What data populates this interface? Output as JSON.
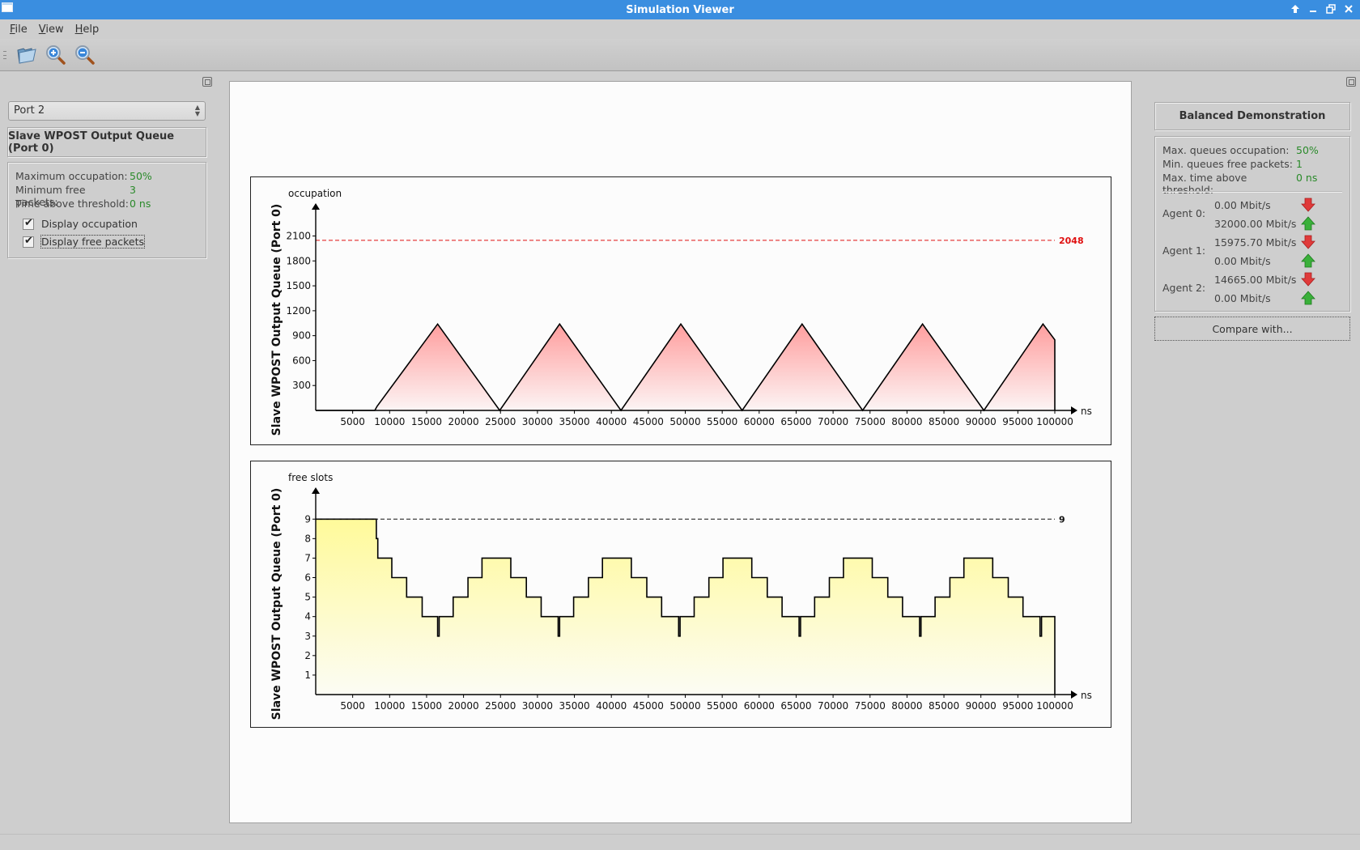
{
  "window": {
    "title": "Simulation Viewer",
    "controls": [
      "keep-above",
      "minimize",
      "maximize",
      "close"
    ]
  },
  "menu": {
    "items": [
      {
        "label": "File",
        "mnemonic": "F",
        "rest": "ile"
      },
      {
        "label": "View",
        "mnemonic": "V",
        "rest": "iew"
      },
      {
        "label": "Help",
        "mnemonic": "H",
        "rest": "elp"
      }
    ]
  },
  "toolbar": {
    "buttons": [
      {
        "name": "open-button",
        "icon": "folder-open-icon"
      },
      {
        "name": "zoom-in-button",
        "icon": "zoom-in-icon"
      },
      {
        "name": "zoom-out-button",
        "icon": "zoom-out-icon"
      }
    ]
  },
  "left_panel": {
    "port_select": {
      "value": "Port 2"
    },
    "queue_title": "Slave WPOST Output Queue (Port 0)",
    "stats": [
      {
        "label": "Maximum occupation:",
        "value": "50%"
      },
      {
        "label": "Minimum free packets:",
        "value": "3"
      },
      {
        "label": "Time above threshold:",
        "value": "0 ns"
      }
    ],
    "checkboxes": [
      {
        "label": "Display occupation",
        "checked": true
      },
      {
        "label": "Display free packets",
        "checked": true
      }
    ]
  },
  "right_panel": {
    "scenario_title": "Balanced Demonstration",
    "summary": [
      {
        "label": "Max. queues occupation:",
        "value": "50%"
      },
      {
        "label": "Min. queues free packets:",
        "value": "1"
      },
      {
        "label": "Max. time above threshold:",
        "value": "0 ns"
      }
    ],
    "agents": [
      {
        "label": "Agent 0:",
        "down": "0.00 Mbit/s",
        "up": "32000.00 Mbit/s"
      },
      {
        "label": "Agent 1:",
        "down": "15975.70 Mbit/s",
        "up": "0.00 Mbit/s"
      },
      {
        "label": "Agent 2:",
        "down": "14665.00 Mbit/s",
        "up": "0.00 Mbit/s"
      }
    ],
    "compare_label": "Compare with...",
    "colors": {
      "down_arrow": "#e03a3a",
      "up_arrow": "#3ab03a",
      "value_green": "#2a8a2a"
    }
  },
  "chart_data": [
    {
      "type": "area",
      "title": "",
      "ylabel": "Slave WPOST Output Queue (Port 0)",
      "y_axis_caption": "occupation",
      "xlabel": "ns",
      "xlim": [
        0,
        100000
      ],
      "ylim": [
        0,
        2300
      ],
      "x_ticks": [
        5000,
        10000,
        15000,
        20000,
        25000,
        30000,
        35000,
        40000,
        45000,
        50000,
        55000,
        60000,
        65000,
        70000,
        75000,
        80000,
        85000,
        90000,
        95000,
        100000
      ],
      "y_ticks": [
        300,
        600,
        900,
        1200,
        1500,
        1800,
        2100
      ],
      "threshold": {
        "value": 2048,
        "label": "2048",
        "color": "#e01010",
        "style": "dashed"
      },
      "fill_color": "#ff9e9e",
      "series": [
        {
          "name": "occupation",
          "x": [
            0,
            8000,
            8300,
            16500,
            24900,
            33000,
            41300,
            49400,
            57700,
            65800,
            74000,
            82100,
            90400,
            98400,
            100000,
            100000
          ],
          "y": [
            0,
            0,
            50,
            1040,
            0,
            1040,
            0,
            1040,
            0,
            1040,
            0,
            1040,
            0,
            1040,
            850,
            0
          ]
        }
      ]
    },
    {
      "type": "area",
      "title": "",
      "ylabel": "Slave WPOST Output Queue (Port 0)",
      "y_axis_caption": "free slots",
      "xlabel": "ns",
      "xlim": [
        0,
        100000
      ],
      "ylim": [
        0,
        9.8
      ],
      "x_ticks": [
        5000,
        10000,
        15000,
        20000,
        25000,
        30000,
        35000,
        40000,
        45000,
        50000,
        55000,
        60000,
        65000,
        70000,
        75000,
        80000,
        85000,
        90000,
        95000,
        100000
      ],
      "y_ticks": [
        1,
        2,
        3,
        4,
        5,
        6,
        7,
        8,
        9
      ],
      "threshold": {
        "value": 9,
        "label": "9",
        "color": "#111111",
        "style": "dashed"
      },
      "fill_color": "#fffa9a",
      "series": [
        {
          "name": "free slots",
          "steps": [
            [
              0,
              9
            ],
            [
              8200,
              8
            ],
            [
              8400,
              7
            ],
            [
              10300,
              6
            ],
            [
              12300,
              5
            ],
            [
              14400,
              4
            ],
            [
              16500,
              3
            ],
            [
              16700,
              4
            ],
            [
              18600,
              5
            ],
            [
              20600,
              6
            ],
            [
              22500,
              7
            ],
            [
              26400,
              6
            ],
            [
              28500,
              5
            ],
            [
              30500,
              4
            ],
            [
              32800,
              3
            ],
            [
              33000,
              4
            ],
            [
              34900,
              5
            ],
            [
              36900,
              6
            ],
            [
              38800,
              7
            ],
            [
              42700,
              6
            ],
            [
              44800,
              5
            ],
            [
              46800,
              4
            ],
            [
              49100,
              3
            ],
            [
              49300,
              4
            ],
            [
              51200,
              5
            ],
            [
              53200,
              6
            ],
            [
              55100,
              7
            ],
            [
              59000,
              6
            ],
            [
              61100,
              5
            ],
            [
              63100,
              4
            ],
            [
              65400,
              3
            ],
            [
              65600,
              4
            ],
            [
              67500,
              5
            ],
            [
              69500,
              6
            ],
            [
              71400,
              7
            ],
            [
              75300,
              6
            ],
            [
              77400,
              5
            ],
            [
              79400,
              4
            ],
            [
              81700,
              3
            ],
            [
              81900,
              4
            ],
            [
              83800,
              5
            ],
            [
              85800,
              6
            ],
            [
              87700,
              7
            ],
            [
              91600,
              6
            ],
            [
              93700,
              5
            ],
            [
              95700,
              4
            ],
            [
              98000,
              3
            ],
            [
              98200,
              4
            ],
            [
              100000,
              0
            ]
          ]
        }
      ]
    }
  ]
}
